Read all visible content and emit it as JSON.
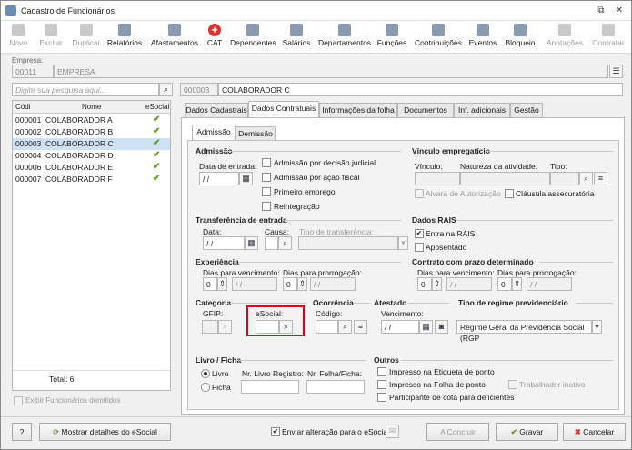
{
  "window": {
    "title": "Cadastro de Funcionários",
    "restore_glyph": "⧉",
    "close_glyph": "✕"
  },
  "toolbar": [
    {
      "label": "Novo",
      "icon": "new-icon",
      "enabled": false
    },
    {
      "label": "Excluir",
      "icon": "delete-icon",
      "enabled": false
    },
    {
      "label": "Duplicar",
      "icon": "duplicate-icon",
      "enabled": false
    },
    {
      "label": "Relatórios",
      "icon": "report-icon",
      "enabled": true
    },
    {
      "label": "Afastamentos",
      "icon": "house-icon",
      "enabled": true
    },
    {
      "label": "CAT",
      "icon": "cross-icon",
      "enabled": true
    },
    {
      "label": "Dependentes",
      "icon": "people-icon",
      "enabled": true
    },
    {
      "label": "Salários",
      "icon": "money-icon",
      "enabled": true
    },
    {
      "label": "Departamentos",
      "icon": "building-icon",
      "enabled": true
    },
    {
      "label": "Funções",
      "icon": "clipboard-icon",
      "enabled": true
    },
    {
      "label": "Contribuições",
      "icon": "contribution-icon",
      "enabled": true
    },
    {
      "label": "Eventos",
      "icon": "events-icon",
      "enabled": true
    },
    {
      "label": "Bloqueio",
      "icon": "lock-icon",
      "enabled": true
    },
    {
      "label": "Anotações",
      "icon": "notes-icon",
      "enabled": false
    },
    {
      "label": "Contratar",
      "icon": "hire-icon",
      "enabled": false
    }
  ],
  "empresa": {
    "label": "Empresa:",
    "code": "00011",
    "name": "EMPRESA"
  },
  "search": {
    "placeholder": "Digite sua pesquisa aqui...",
    "icon": "search-icon"
  },
  "colaborador": {
    "code": "000003",
    "name": "COLABORADOR C"
  },
  "list": {
    "headers": {
      "code": "Códi",
      "name": "Nome",
      "esocial": "eSocial"
    },
    "rows": [
      {
        "code": "000001",
        "name": "COLABORADOR A",
        "esocial": "✔"
      },
      {
        "code": "000002",
        "name": "COLABORADOR B",
        "esocial": "✔"
      },
      {
        "code": "000003",
        "name": "COLABORADOR C",
        "esocial": "✔"
      },
      {
        "code": "000004",
        "name": "COLABORADOR D",
        "esocial": "✔"
      },
      {
        "code": "000006",
        "name": "COLABORADOR E",
        "esocial": "✔"
      },
      {
        "code": "000007",
        "name": "COLABORADOR F",
        "esocial": "✔"
      }
    ],
    "total": "Total: 6",
    "show_dismissed": "Exibir Funcionários demitidos"
  },
  "tabs": [
    "Dados Cadastrais",
    "Dados Contratuais",
    "Informações da folha",
    "Documentos",
    "Inf. adicionais",
    "Gestão"
  ],
  "subtabs": [
    "Admissão",
    "Demissão"
  ],
  "admissao": {
    "title": "Admissão",
    "date_label": "Data de entrada:",
    "date_value": "/ /",
    "checks": [
      "Admissão por decisão judicial",
      "Admissão por ação fiscal",
      "Primeiro emprego",
      "Reintegração"
    ]
  },
  "vinculo": {
    "title": "Vínculo empregatício",
    "vinculo_label": "Vínculo:",
    "natureza_label": "Natureza da atividade:",
    "tipo_label": "Tipo:",
    "alvara": "Alvará de Autorização",
    "clausula": "Cláusula assecuratória"
  },
  "transferencia": {
    "title": "Transferência de entrada",
    "data_label": "Data:",
    "data_value": "/ /",
    "causa_label": "Causa:",
    "tipo_label": "Tipo de transferência:"
  },
  "rais": {
    "title": "Dados RAIS",
    "entra": "Entra na RAIS",
    "aposentado": "Aposentado"
  },
  "experiencia": {
    "title": "Experiência",
    "dias_venc": "Dias para vencimento:",
    "dias_prorr": "Dias para prorrogação:",
    "venc_value": "0",
    "prorr_value": "0",
    "date_value": "/ /"
  },
  "contrato": {
    "title": "Contrato com prazo determinado",
    "dias_venc": "Dias para vencimento:",
    "dias_prorr": "Dias para prorrogação:",
    "venc_value": "0",
    "prorr_value": "0",
    "date_value": "/ /"
  },
  "categoria": {
    "title": "Categoria",
    "gfip": "GFIP:",
    "esocial": "eSocial:"
  },
  "ocorrencia": {
    "title": "Ocorrência",
    "codigo": "Código:"
  },
  "atestado": {
    "title": "Atestado",
    "vencimento": "Vencimento:",
    "date_value": "/ /"
  },
  "regime": {
    "title": "Tipo de regime previdenciário",
    "value": "Regime Geral da Previdência Social (RGP"
  },
  "livro": {
    "title": "Livro / Ficha",
    "options": [
      "Livro",
      "Ficha"
    ],
    "nr_livro": "Nr. Livro Registro:",
    "nr_folha": "Nr. Folha/Ficha:"
  },
  "outros": {
    "title": "Outros",
    "checks": [
      "Impresso na Etiqueta de ponto",
      "Impresso na Folha de ponto",
      "Participante de cota para deficientes"
    ],
    "trabalhador": "Trabalhador inativo"
  },
  "footer": {
    "help": "?",
    "details": "Mostrar detalhes do eSocial",
    "enviar": "Enviar alteração para o eSocial",
    "concluir": "A Concluir",
    "gravar": "Gravar",
    "cancelar": "Cancelar"
  }
}
